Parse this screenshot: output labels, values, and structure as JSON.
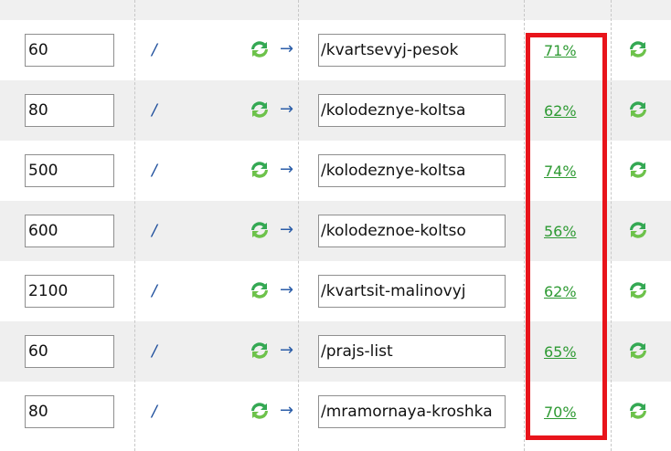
{
  "rows": [
    {
      "quantity": "60",
      "slash": "/",
      "arrow": "→",
      "path": "/kvartsevyj-pesok",
      "percent": "71%"
    },
    {
      "quantity": "80",
      "slash": "/",
      "arrow": "→",
      "path": "/kolodeznye-koltsa",
      "percent": "62%"
    },
    {
      "quantity": "500",
      "slash": "/",
      "arrow": "→",
      "path": "/kolodeznye-koltsa",
      "percent": "74%"
    },
    {
      "quantity": "600",
      "slash": "/",
      "arrow": "→",
      "path": "/kolodeznoe-koltso",
      "percent": "56%"
    },
    {
      "quantity": "2100",
      "slash": "/",
      "arrow": "→",
      "path": "/kvartsit-malinovyj",
      "percent": "62%"
    },
    {
      "quantity": "60",
      "slash": "/",
      "arrow": "→",
      "path": "/prajs-list",
      "percent": "65%"
    },
    {
      "quantity": "80",
      "slash": "/",
      "arrow": "→",
      "path": "/mramornaya-kroshka",
      "percent": "70%"
    }
  ],
  "icons": {
    "refresh": "refresh-icon",
    "arrow": "right-arrow-icon"
  },
  "colors": {
    "percent_link": "#2e9a33",
    "highlight_box": "#e8141b",
    "row_alt": "#efefef",
    "arrow": "#2b5da8"
  }
}
